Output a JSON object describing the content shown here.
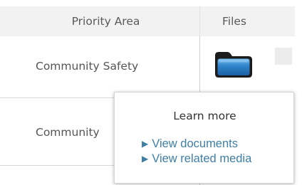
{
  "table": {
    "headers": {
      "priority_area": "Priority Area",
      "files": "Files"
    },
    "rows": [
      {
        "priority_area": "Community Safety"
      },
      {
        "priority_area": "Community"
      }
    ]
  },
  "tooltip": {
    "title": "Learn more",
    "links": [
      {
        "label": "View documents",
        "icon": "triangle-right-icon"
      },
      {
        "label": "View related media",
        "icon": "triangle-right-icon"
      }
    ]
  },
  "icons": {
    "files": "folder-icon"
  },
  "colors": {
    "header_bg": "#f2f2f2",
    "link": "#3f7fa6",
    "folder_fill": "#2e82c9"
  }
}
